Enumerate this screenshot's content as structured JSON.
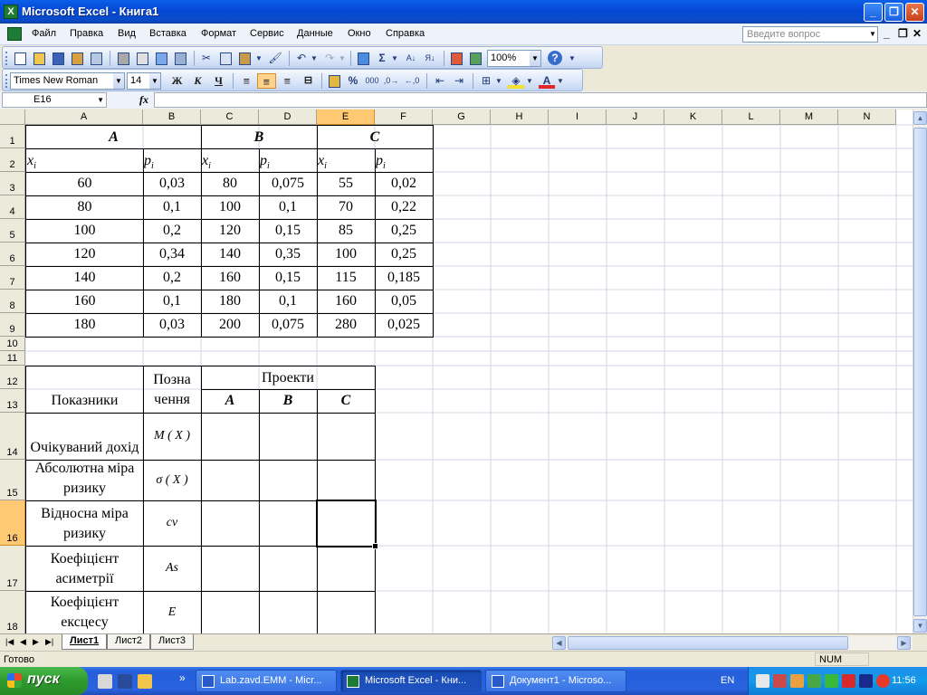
{
  "window": {
    "title": "Microsoft Excel - Книга1",
    "app_icon_letter": "X",
    "minimize": "_",
    "maximize": "❐",
    "close": "✕"
  },
  "menu": {
    "items": [
      "Файл",
      "Правка",
      "Вид",
      "Вставка",
      "Формат",
      "Сервис",
      "Данные",
      "Окно",
      "Справка"
    ],
    "help_placeholder": "Введите вопрос",
    "mdi_min": "_",
    "mdi_restore": "❐",
    "mdi_close": "✕"
  },
  "toolbar": {
    "zoom": "100%",
    "sigma": "Σ",
    "sort_asc": "А↓",
    "sort_desc": "Я↓"
  },
  "format_toolbar": {
    "font": "Times New Roman",
    "size": "14",
    "bold": "Ж",
    "italic": "К",
    "underline": "Ч",
    "percent": "%",
    "thousands": "000",
    "font_color_letter": "A"
  },
  "formula_bar": {
    "name_box": "E16",
    "fx": "fx",
    "value": ""
  },
  "columns": [
    "A",
    "B",
    "C",
    "D",
    "E",
    "F",
    "G",
    "H",
    "I",
    "J",
    "K",
    "L",
    "M",
    "N"
  ],
  "rows": [
    "1",
    "2",
    "3",
    "4",
    "5",
    "6",
    "7",
    "8",
    "9",
    "10",
    "11",
    "12",
    "13",
    "14",
    "15",
    "16",
    "17",
    "18"
  ],
  "selected": {
    "col": "E",
    "row": "16"
  },
  "table1": {
    "groups": [
      "A",
      "B",
      "C"
    ],
    "x_label": "x",
    "p_label": "p",
    "sub": "i",
    "rows": [
      [
        "60",
        "0,03",
        "80",
        "0,075",
        "55",
        "0,02"
      ],
      [
        "80",
        "0,1",
        "100",
        "0,1",
        "70",
        "0,22"
      ],
      [
        "100",
        "0,2",
        "120",
        "0,15",
        "85",
        "0,25"
      ],
      [
        "120",
        "0,34",
        "140",
        "0,35",
        "100",
        "0,25"
      ],
      [
        "140",
        "0,2",
        "160",
        "0,15",
        "115",
        "0,185"
      ],
      [
        "160",
        "0,1",
        "180",
        "0,1",
        "160",
        "0,05"
      ],
      [
        "180",
        "0,03",
        "200",
        "0,075",
        "280",
        "0,025"
      ]
    ]
  },
  "table2": {
    "header_indicators": "Показники",
    "header_notation": "Позна чення",
    "header_projects": "Проекти",
    "projects": [
      "A",
      "B",
      "C"
    ],
    "rows": [
      {
        "label": "Очікуваний дохід",
        "notation": "M ( X )"
      },
      {
        "label": "Абсолютна міра ризику",
        "notation": "σ ( X )"
      },
      {
        "label": "Відносна міра ризику",
        "notation": "cv"
      },
      {
        "label": "Коефіцієнт асиметрії",
        "notation": "As"
      },
      {
        "label": "Коефіцієнт ексцесу",
        "notation": "E"
      }
    ]
  },
  "sheet_tabs": [
    "Лист1",
    "Лист2",
    "Лист3"
  ],
  "tab_nav": [
    "|◀",
    "◀",
    "▶",
    "▶|"
  ],
  "status": {
    "text": "Готово",
    "num": "NUM"
  },
  "taskbar": {
    "start": "пуск",
    "buttons": [
      {
        "label": "Lab.zavd.EMM - Micr...",
        "active": false
      },
      {
        "label": "Microsoft Excel - Кни...",
        "active": true
      },
      {
        "label": "Документ1 - Microso...",
        "active": false
      }
    ],
    "chevron": "»",
    "lang": "EN",
    "clock": "11:56"
  },
  "colors": {
    "excel_green": "#1E7B34",
    "selection_orange": "#FFC873",
    "xp_blue": "#245EDB",
    "start_green": "#2E9A2E"
  }
}
